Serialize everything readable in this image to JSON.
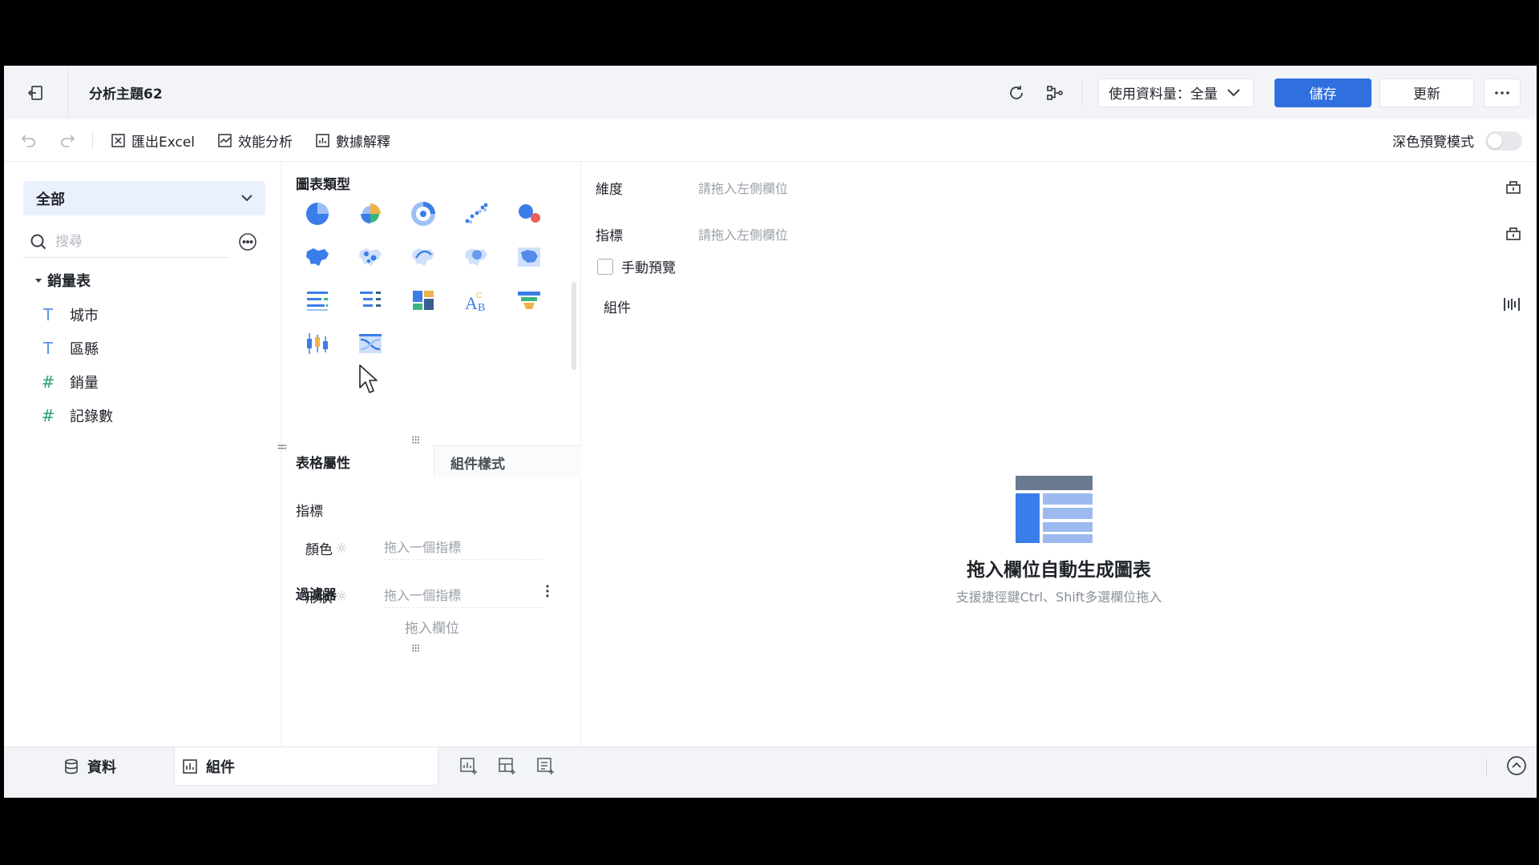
{
  "header": {
    "title": "分析主題62",
    "data_select_label": "使用資料量：全量",
    "save_label": "儲存",
    "update_label": "更新"
  },
  "toolbar": {
    "export_label": "匯出Excel",
    "perf_label": "效能分析",
    "explain_label": "數據解釋",
    "dark_mode_label": "深色預覽模式",
    "dark_mode_on": false
  },
  "data_panel": {
    "category": "全部",
    "search_placeholder": "搜尋",
    "table_name": "銷量表",
    "fields": [
      {
        "type": "T",
        "name": "城市"
      },
      {
        "type": "T",
        "name": "區縣"
      },
      {
        "type": "#",
        "name": "銷量"
      },
      {
        "type": "#",
        "name": "記錄數"
      }
    ]
  },
  "chart_panel": {
    "chart_type_heading": "圖表類型",
    "tab_table_props": "表格屬性",
    "tab_component_style": "組件樣式",
    "indicator_heading": "指標",
    "color_label": "顏色",
    "shape_label": "形狀",
    "drop_indicator_hint": "拖入一個指標",
    "filter_heading": "過濾器",
    "filter_drop_hint": "拖入欄位"
  },
  "main": {
    "dimension_label": "維度",
    "indicator_label": "指標",
    "drop_hint": "請拖入左側欄位",
    "manual_preview_label": "手動預覽",
    "component_label": "組件",
    "empty_title": "拖入欄位自動生成圖表",
    "empty_subtitle": "支援捷徑鍵Ctrl、Shift多選欄位拖入"
  },
  "bottom": {
    "data_tab": "資料",
    "component_tab": "組件"
  },
  "colors": {
    "primary": "#2f6fe0",
    "header_bg": "#f3f4f7",
    "selected_bg": "#eaf0fd"
  }
}
